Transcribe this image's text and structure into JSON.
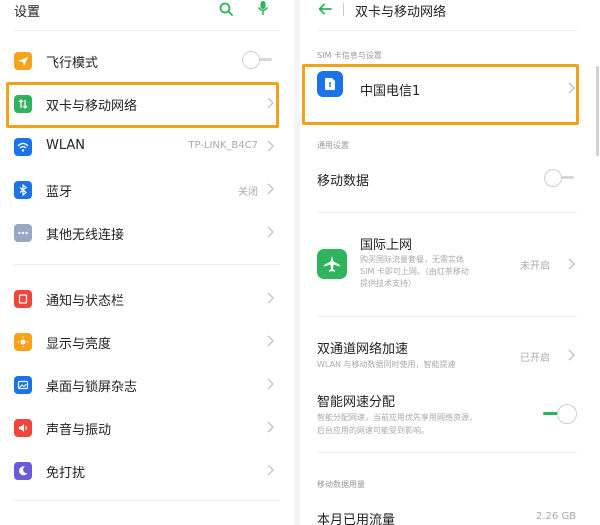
{
  "left": {
    "title": "设置",
    "items": [
      {
        "label": "飞行模式",
        "value": "",
        "icon": "airplane-icon",
        "color": "#f7a21b"
      },
      {
        "label": "双卡与移动网络",
        "value": "",
        "icon": "dual-sim-icon",
        "color": "#2fb35c"
      },
      {
        "label": "WLAN",
        "value": "TP-LINK_B4C7",
        "icon": "wifi-icon",
        "color": "#1a73e8"
      },
      {
        "label": "蓝牙",
        "value": "关闭",
        "icon": "bluetooth-icon",
        "color": "#1a73e8"
      },
      {
        "label": "其他无线连接",
        "value": "",
        "icon": "more-connections-icon",
        "color": "#9aa7c4"
      },
      {
        "label": "通知与状态栏",
        "value": "",
        "icon": "notification-icon",
        "color": "#f0453a"
      },
      {
        "label": "显示与亮度",
        "value": "",
        "icon": "brightness-icon",
        "color": "#f7a21b"
      },
      {
        "label": "桌面与锁屏杂志",
        "value": "",
        "icon": "wallpaper-icon",
        "color": "#1a73e8"
      },
      {
        "label": "声音与振动",
        "value": "",
        "icon": "sound-icon",
        "color": "#f0453a"
      },
      {
        "label": "免打扰",
        "value": "",
        "icon": "do-not-disturb-icon",
        "color": "#6b5bd6"
      }
    ]
  },
  "right": {
    "title": "双卡与移动网络",
    "sim_section": "SIM 卡信息与设置",
    "sim_name": "中国电信1",
    "general_section": "通用设置",
    "mobile_data": "移动数据",
    "intl": {
      "title": "国际上网",
      "desc1": "购买国际流量套餐，无需实体",
      "desc2": "SIM 卡即可上网。（由红茶移动",
      "desc3": "提供技术支持）",
      "value": "未开启"
    },
    "dual_accel": {
      "title": "双通道网络加速",
      "desc": "WLAN 与移动数据同时使用，智能提速",
      "value": "已开启"
    },
    "smart_alloc": {
      "title": "智能网速分配",
      "desc1": "智能分配网速，当前应用优先享用网络资源，",
      "desc2": "后台应用的网速可能受到影响。"
    },
    "usage_section": "移动数据用量",
    "monthly": {
      "label": "本月已用流量",
      "value": "2.26 GB"
    }
  },
  "colors": {
    "highlight": "#f0a21a",
    "accent_green": "#2fb35c",
    "accent_blue": "#1a73e8"
  }
}
